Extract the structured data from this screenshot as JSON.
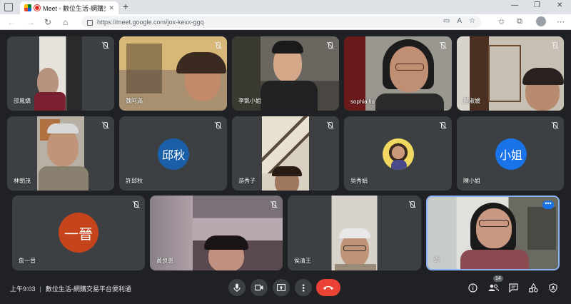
{
  "browser": {
    "tab_title": "Meet - 數位生活-網購交易平",
    "url": "https://meet.google.com/jox-kexx-ggq"
  },
  "tiles": [
    {
      "name": "邵鳳嬌",
      "muted": true
    },
    {
      "name": "魏阿滿",
      "muted": true
    },
    {
      "name": "李凱小姐",
      "muted": true
    },
    {
      "name": "sophia liu",
      "muted": true
    },
    {
      "name": "藍淑媛",
      "muted": true
    },
    {
      "name": "林朝茂",
      "muted": true
    },
    {
      "name": "許邱秋",
      "muted": true,
      "initials": "邱秋",
      "color": "#1a5fa8"
    },
    {
      "name": "游秀子",
      "muted": true
    },
    {
      "name": "吳秀娟",
      "muted": true
    },
    {
      "name": "陳小姐",
      "muted": true,
      "initials": "小姐",
      "color": "#1a73e8"
    },
    {
      "name": "詹一晉",
      "muted": true,
      "initials": "一晉",
      "color": "#c5441c"
    },
    {
      "name": "黃良惠",
      "muted": true
    },
    {
      "name": "侯清王",
      "muted": true
    },
    {
      "name": "你",
      "muted": false
    }
  ],
  "bottom_bar": {
    "time": "上午9:03",
    "meeting_title": "數位生活-網購交易平台便利通",
    "participant_count": "14"
  },
  "colors": {
    "background": "#202124",
    "hangup": "#ea4335",
    "accent": "#1a73e8"
  }
}
